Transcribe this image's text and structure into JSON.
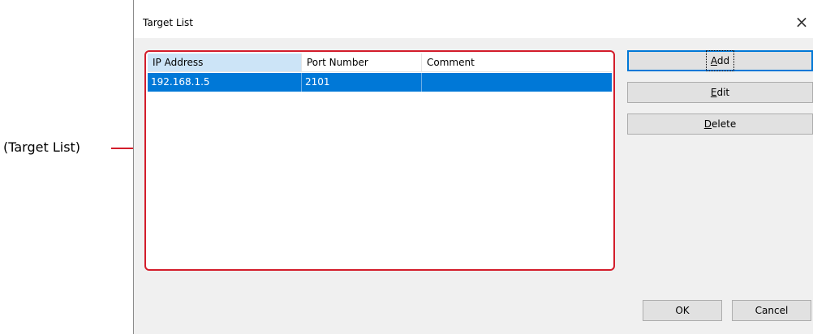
{
  "callout": {
    "label": "(Target List)"
  },
  "dialog": {
    "title": "Target List",
    "close_glyph": "×"
  },
  "list": {
    "columns": [
      "IP Address",
      "Port Number",
      "Comment"
    ],
    "rows": [
      {
        "ip": "192.168.1.5",
        "port": "2101",
        "comment": ""
      }
    ]
  },
  "buttons": {
    "add": {
      "mnemonic": "A",
      "rest": "dd"
    },
    "edit": {
      "mnemonic": "E",
      "rest": "dit"
    },
    "delete": {
      "mnemonic": "D",
      "rest": "elete"
    },
    "ok": "OK",
    "cancel": "Cancel"
  },
  "icons": {
    "close": "close-icon"
  },
  "colors": {
    "selection": "#0078d7",
    "callout": "#d31d2b",
    "header_active": "#cce4f7"
  }
}
